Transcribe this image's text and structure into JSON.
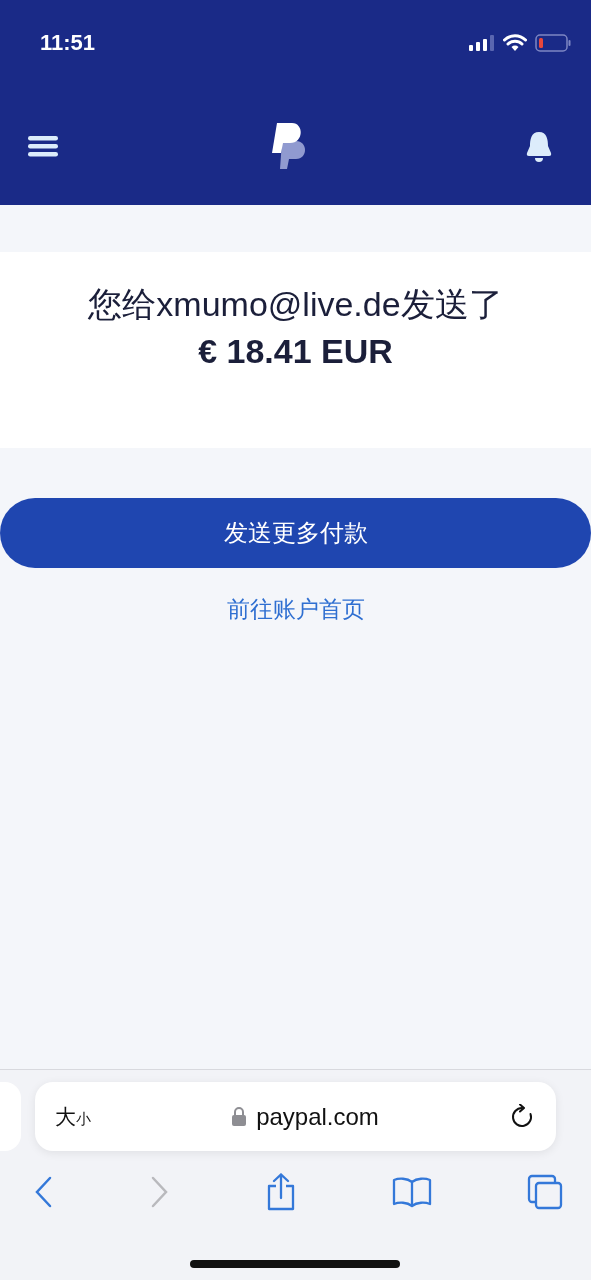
{
  "status_bar": {
    "time": "11:51"
  },
  "confirmation": {
    "message": "您给xmumo@live.de发送了",
    "amount": "€ 18.41 EUR"
  },
  "primary_button": {
    "label": "发送更多付款"
  },
  "link": {
    "label": "前往账户首页"
  },
  "browser": {
    "text_size": {
      "large": "大",
      "small": "小"
    },
    "url": "paypal.com",
    "toolbar": [
      {
        "kind": "back",
        "disabled": false
      },
      {
        "kind": "forward",
        "disabled": true
      },
      {
        "kind": "share",
        "disabled": false
      },
      {
        "kind": "bookmarks",
        "disabled": false
      },
      {
        "kind": "tabs",
        "disabled": false
      }
    ]
  }
}
